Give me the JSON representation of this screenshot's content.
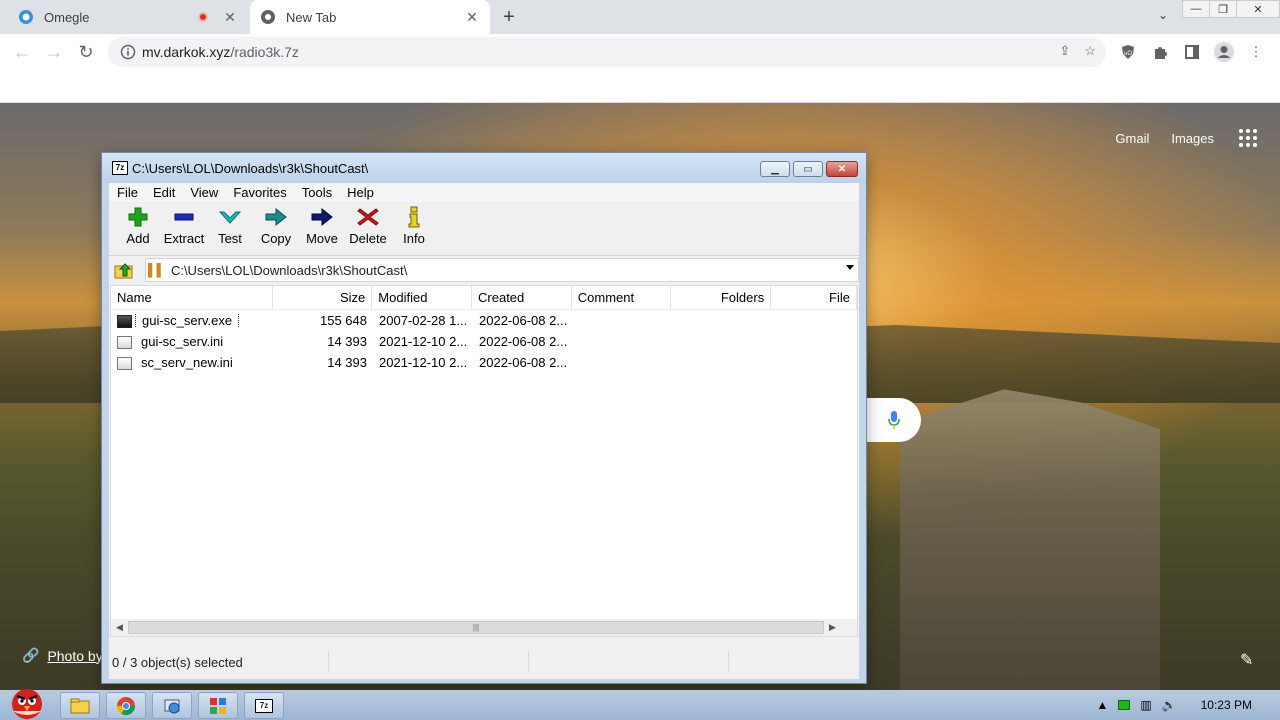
{
  "browser": {
    "tabs": [
      {
        "title": "Omegle",
        "active": false,
        "recording": true
      },
      {
        "title": "New Tab",
        "active": true,
        "recording": false
      }
    ],
    "url_domain": "mv.darkok.xyz",
    "url_path": "/radio3k.7z"
  },
  "newtab": {
    "gmail": "Gmail",
    "images": "Images",
    "photo_by": "Photo by"
  },
  "sevenzip": {
    "title": "C:\\Users\\LOL\\Downloads\\r3k\\ShoutCast\\",
    "menu": [
      "File",
      "Edit",
      "View",
      "Favorites",
      "Tools",
      "Help"
    ],
    "toolbar": {
      "add": "Add",
      "extract": "Extract",
      "test": "Test",
      "copy": "Copy",
      "move": "Move",
      "delete": "Delete",
      "info": "Info"
    },
    "path": "C:\\Users\\LOL\\Downloads\\r3k\\ShoutCast\\",
    "columns": {
      "name": "Name",
      "size": "Size",
      "modified": "Modified",
      "created": "Created",
      "comment": "Comment",
      "folders": "Folders",
      "files": "File"
    },
    "files": [
      {
        "name": "gui-sc_serv.exe",
        "size": "155 648",
        "modified": "2007-02-28 1...",
        "created": "2022-06-08 2..."
      },
      {
        "name": "gui-sc_serv.ini",
        "size": "14 393",
        "modified": "2021-12-10 2...",
        "created": "2022-06-08 2..."
      },
      {
        "name": "sc_serv_new.ini",
        "size": "14 393",
        "modified": "2021-12-10 2...",
        "created": "2022-06-08 2..."
      }
    ],
    "status": "0 / 3 object(s) selected"
  },
  "taskbar": {
    "clock": "10:23 PM"
  }
}
